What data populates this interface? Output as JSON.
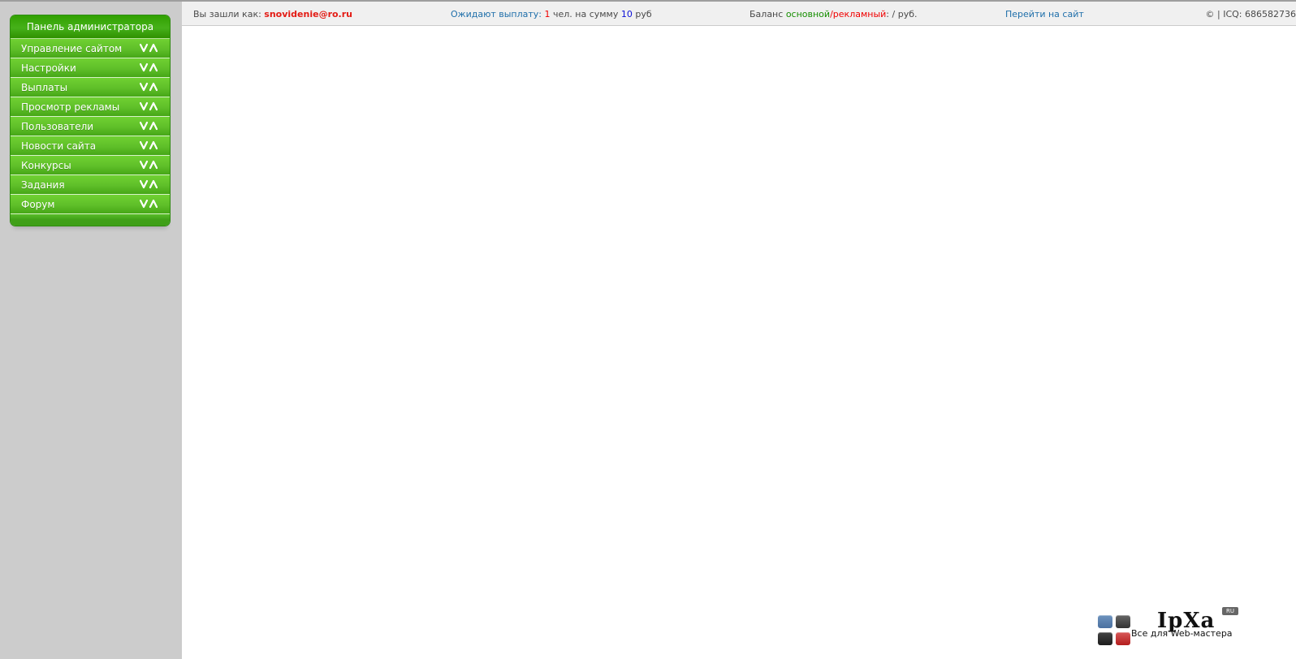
{
  "menu": {
    "title": "Панель администратора",
    "items": [
      {
        "label": "Управление сайтом"
      },
      {
        "label": "Настройки"
      },
      {
        "label": "Выплаты"
      },
      {
        "label": "Просмотр рекламы"
      },
      {
        "label": "Пользователи"
      },
      {
        "label": "Новости сайта"
      },
      {
        "label": "Конкурсы"
      },
      {
        "label": "Задания"
      },
      {
        "label": "Форум"
      }
    ]
  },
  "topbar": {
    "logged_in_prefix": "Вы зашли как:",
    "user_email": "snovidenie@ro.ru",
    "payout_label": "Ожидают выплату:",
    "payout_count": "1",
    "payout_middle": "чел. на сумму",
    "payout_amount": "10",
    "payout_currency": "руб",
    "balance_prefix": "Баланс",
    "balance_main_label": "основной",
    "balance_separator": "/",
    "balance_ads_label": "рекламный",
    "balance_colon": ":",
    "balance_values": "/ руб.",
    "go_to_site": "Перейти на сайт",
    "copyright": "© | ICQ: 686582736"
  },
  "logo": {
    "title": "IpXa",
    "badge": "RU",
    "subtitle": "Все для Web-мастера"
  },
  "colors": {
    "menu_green": "#58b92d",
    "accent_blue": "#1f6faa",
    "accent_red": "#f00000",
    "accent_green": "#158e00",
    "accent_navy": "#0d11d8"
  }
}
